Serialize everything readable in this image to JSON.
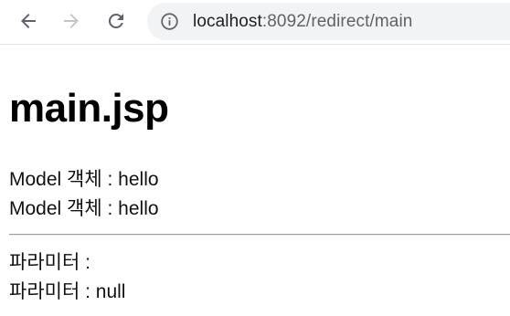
{
  "browser": {
    "back_icon": "arrow-left-icon",
    "forward_icon": "arrow-right-icon",
    "reload_icon": "reload-icon",
    "site_info_icon": "info-circle-icon",
    "url_host": "localhost",
    "url_rest": ":8092/redirect/main"
  },
  "page": {
    "title": "main.jsp",
    "model_lines": [
      "Model 객체 : hello",
      "Model 객체 : hello"
    ],
    "param_lines": [
      "파라미터 :",
      "파라미터 : null"
    ]
  },
  "colors": {
    "omnibox_bg": "#f1f3f4",
    "icon_active": "#5f6368",
    "icon_disabled": "#c4c7c9",
    "divider": "#9a9a9a"
  }
}
